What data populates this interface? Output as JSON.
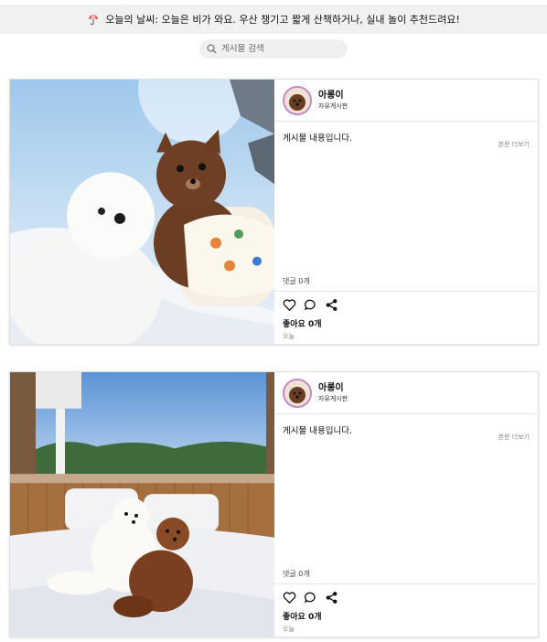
{
  "weather": {
    "text": "오늘의 날씨: 오늘은 비가 와요. 우산 챙기고 짧게 산책하거나, 실내 놀이 추천드려요!",
    "icon": "umbrella-icon"
  },
  "search": {
    "placeholder": "게시물 검색",
    "icon": "search-icon"
  },
  "posts": [
    {
      "author": "아롱이",
      "board": "자유게시판",
      "content": "게시물 내용입니다.",
      "more": "본문 더보기",
      "comments": "댓글 0개",
      "likes": "좋아요 0개",
      "time": "오늘"
    },
    {
      "author": "아롱이",
      "board": "자유게시판",
      "content": "게시물 내용입니다.",
      "more": "본문 더보기",
      "comments": "댓글 0개",
      "likes": "좋아요 0개",
      "time": "오늘"
    }
  ],
  "icons": {
    "like": "heart-icon",
    "comment": "comment-icon",
    "share": "share-icon"
  }
}
